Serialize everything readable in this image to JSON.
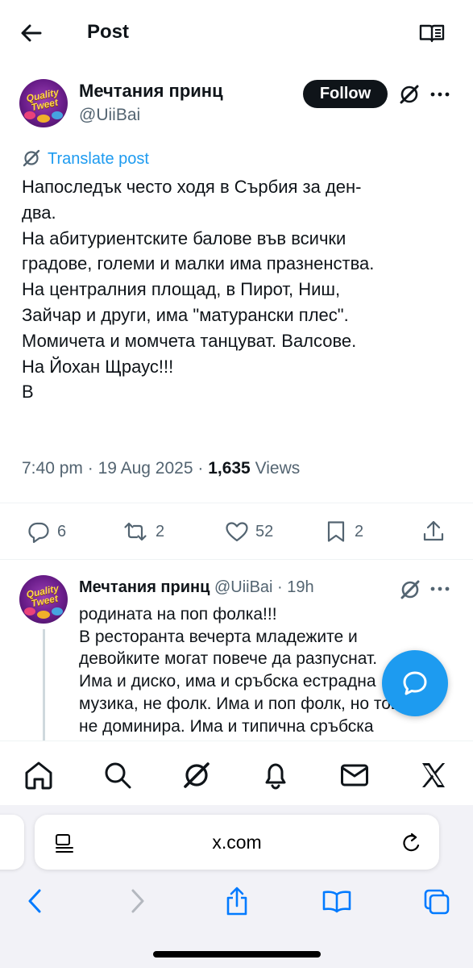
{
  "header": {
    "title": "Post",
    "back_icon": "arrow-left-icon",
    "reader_icon": "reader-mode-icon"
  },
  "author": {
    "avatar_text": "Quality Tweet",
    "name": "Мечтания принц",
    "handle": "@UiiBai",
    "follow_label": "Follow"
  },
  "translate_label": "Translate post",
  "post": {
    "lines": [
      "Напоследък често ходя в Сърбия за ден-",
      "два.",
      "На абитуриентските балове във всички",
      "градове, големи и малки има празненства.",
      "На централния площад, в Пирот, Ниш,",
      "Зайчар и други, има \"матурански плес\".",
      "Момичета и момчета танцуват. Валсове.",
      "На Йохан Щраус!!!",
      "В"
    ],
    "time": "7:40 pm",
    "date": "19 Aug 2025",
    "views_count": "1,635",
    "views_label": "Views"
  },
  "actions": {
    "replies": "6",
    "reposts": "2",
    "likes": "52",
    "bookmarks": "2"
  },
  "reply": {
    "name": "Мечтания принц",
    "handle": "@UiiBai",
    "time": "19h",
    "lines": [
      "родината на поп фолка!!!",
      "В ресторанта вечерта младежите и",
      "девойките могат повече да разпуснат.",
      "Има и диско, има и сръбска естрадна",
      "музика, не фолк. Има и поп фолк, но това",
      "не доминира. Има и типична сръбска"
    ]
  },
  "tabbar": [
    "home-icon",
    "search-icon",
    "grok-icon",
    "notifications-icon",
    "messages-icon",
    "x-logo-icon"
  ],
  "browser": {
    "url": "x.com"
  },
  "colors": {
    "accent": "#1d9bf0",
    "text": "#0f1419",
    "secondary": "#536471",
    "safari_blue": "#007aff"
  }
}
